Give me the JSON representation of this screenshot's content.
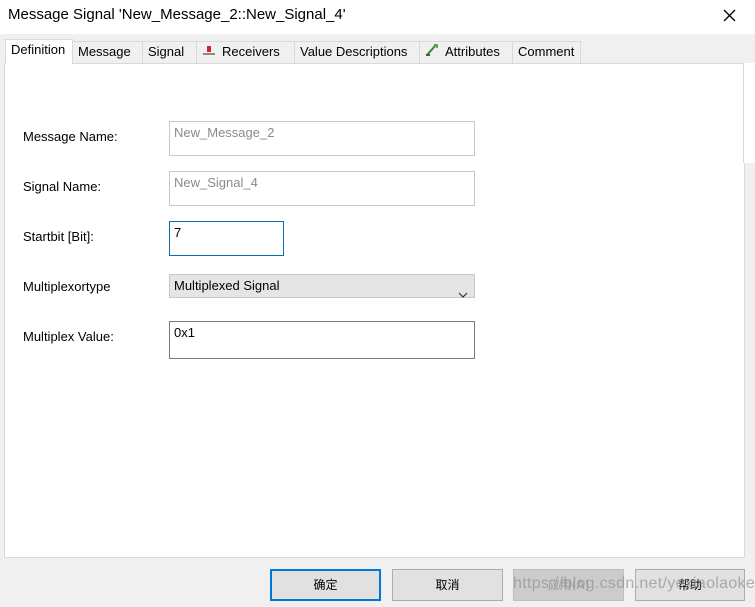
{
  "window": {
    "title": "Message Signal 'New_Message_2::New_Signal_4'",
    "close_icon": "close-icon"
  },
  "tabs": [
    {
      "label": "Definition",
      "active": true
    },
    {
      "label": "Message"
    },
    {
      "label": "Signal"
    },
    {
      "label": "Receivers",
      "icon": "receivers-icon"
    },
    {
      "label": "Value Descriptions"
    },
    {
      "label": "Attributes",
      "icon": "attributes-icon"
    },
    {
      "label": "Comment"
    }
  ],
  "form": {
    "message_name_label": "Message Name:",
    "message_name_value": "New_Message_2",
    "signal_name_label": "Signal Name:",
    "signal_name_value": "New_Signal_4",
    "startbit_label": "Startbit [Bit]:",
    "startbit_value": "7",
    "multiplexortype_label": "Multiplexortype",
    "multiplexortype_value": "Multiplexed Signal",
    "multiplex_value_label": "Multiplex Value:",
    "multiplex_value": "0x1"
  },
  "buttons": {
    "ok": "确定",
    "cancel": "取消",
    "apply": "应用(A)",
    "help": "帮助"
  },
  "watermark": "https://blog.csdn.net/yexiaolaoke",
  "colors": {
    "focus_border": "#0a6fb7",
    "default_button_border": "#0078d7",
    "dialog_background": "#f0f0f0"
  }
}
